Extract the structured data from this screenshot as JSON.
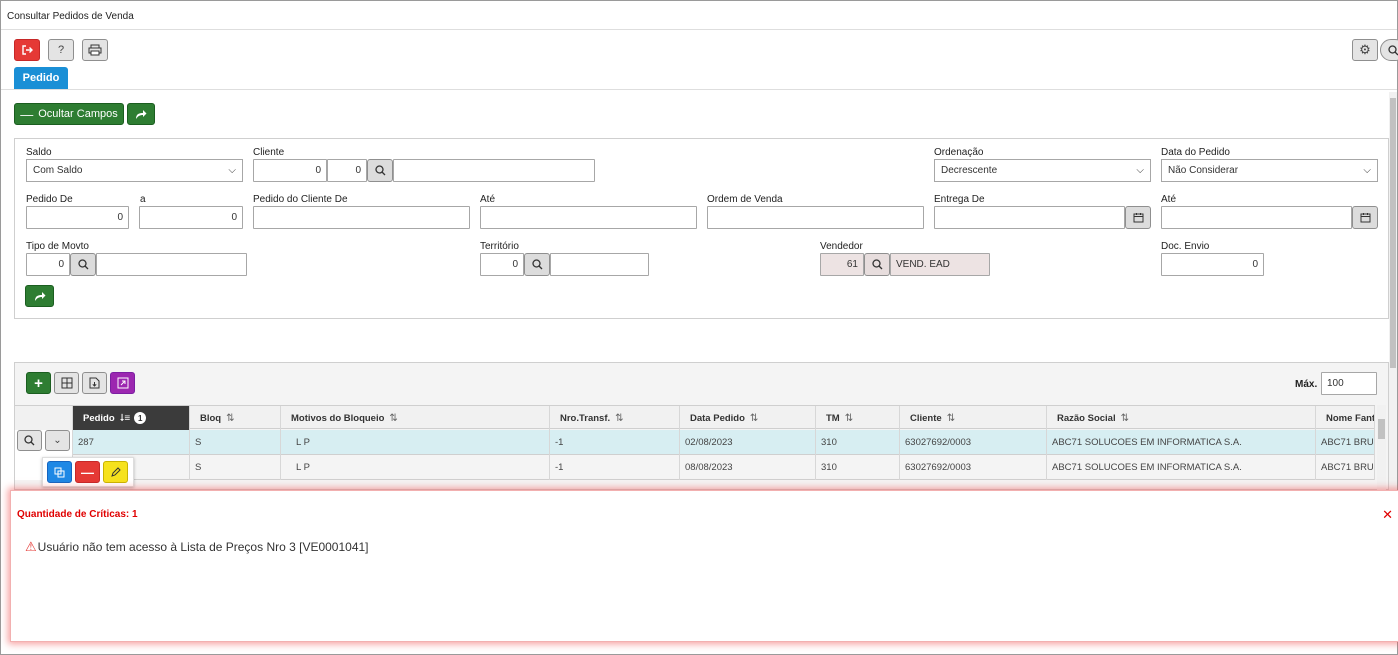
{
  "window": {
    "title": "Consultar Pedidos de Venda"
  },
  "toolbar": {
    "help_label": "?"
  },
  "tabs": {
    "pedido": "Pedido"
  },
  "actions": {
    "hide_fields_label": "Ocultar Campos"
  },
  "filters": {
    "saldo": {
      "label": "Saldo",
      "value": "Com Saldo"
    },
    "cliente": {
      "label": "Cliente",
      "code1": "0",
      "code2": "0",
      "name": ""
    },
    "ordenacao": {
      "label": "Ordenação",
      "value": "Decrescente"
    },
    "data_pedido": {
      "label": "Data do Pedido",
      "value": "Não Considerar"
    },
    "pedido_de": {
      "label": "Pedido De",
      "value": "0"
    },
    "pedido_ate": {
      "label": "a",
      "value": "0"
    },
    "pedido_cliente_de": {
      "label": "Pedido do Cliente De",
      "value": ""
    },
    "pedido_cliente_ate": {
      "label": "Até",
      "value": ""
    },
    "ordem_venda": {
      "label": "Ordem de Venda",
      "value": ""
    },
    "entrega_de": {
      "label": "Entrega De",
      "value": ""
    },
    "entrega_ate": {
      "label": "Até",
      "value": ""
    },
    "tipo_movto": {
      "label": "Tipo de Movto",
      "code": "0",
      "name": ""
    },
    "territorio": {
      "label": "Território",
      "code": "0",
      "name": ""
    },
    "vendedor": {
      "label": "Vendedor",
      "code": "61",
      "name": "VEND. EAD"
    },
    "doc_envio": {
      "label": "Doc. Envio",
      "value": "0"
    }
  },
  "grid": {
    "max_label": "Máx.",
    "max_value": "100",
    "sort_badge": "1",
    "columns": [
      "Pedido",
      "Bloq",
      "Motivos do Bloqueio",
      "Nro.Transf.",
      "Data Pedido",
      "TM",
      "Cliente",
      "Razão Social",
      "Nome Fant"
    ],
    "rows": [
      [
        "287",
        "S",
        "L P",
        "-1",
        "02/08/2023",
        "310",
        "63027692/0003",
        "ABC71 SOLUCOES EM INFORMATICA S.A.",
        "ABC71 BRU"
      ],
      [
        "",
        "S",
        "L P",
        "-1",
        "08/08/2023",
        "310",
        "63027692/0003",
        "ABC71 SOLUCOES EM INFORMATICA S.A.",
        "ABC71 BRU"
      ]
    ]
  },
  "critics": {
    "title": "Quantidade de Críticas: 1",
    "message": "Usuário não tem acesso à Lista de Preços Nro 3 [VE0001041]"
  },
  "colors": {
    "accent_blue": "#1a8fd6",
    "green": "#2e7d32",
    "red": "#e53935",
    "critic_red": "#e00000",
    "selected_row": "#d7eef2"
  }
}
